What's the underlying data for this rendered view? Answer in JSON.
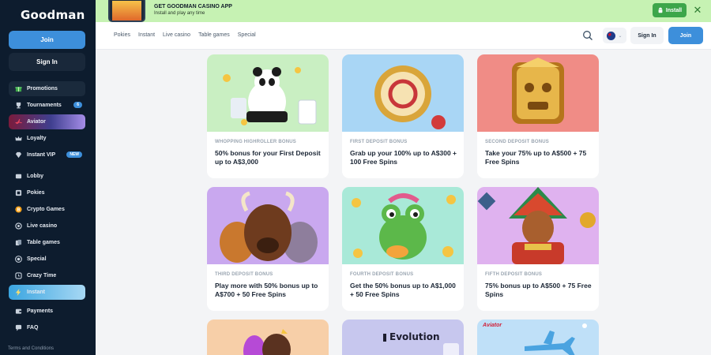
{
  "sidebar": {
    "logo": "Goodman",
    "join_label": "Join",
    "signin_label": "Sign In",
    "menu_group1": [
      {
        "label": "Promotions",
        "icon": "gift-icon"
      },
      {
        "label": "Tournaments",
        "icon": "trophy-icon",
        "badge": "6"
      },
      {
        "label": "Aviator",
        "icon": "plane-icon"
      },
      {
        "label": "Loyalty",
        "icon": "crown-icon"
      },
      {
        "label": "Instant VIP",
        "icon": "diamond-icon",
        "badge": "NEW"
      }
    ],
    "menu_group2": [
      {
        "label": "Lobby",
        "icon": "lobby-icon"
      },
      {
        "label": "Pokies",
        "icon": "cherry-icon"
      },
      {
        "label": "Crypto Games",
        "icon": "bitcoin-icon"
      },
      {
        "label": "Live casino",
        "icon": "live-icon"
      },
      {
        "label": "Table games",
        "icon": "cards-icon"
      },
      {
        "label": "Special",
        "icon": "star-icon"
      },
      {
        "label": "Crazy Time",
        "icon": "clock-icon"
      },
      {
        "label": "Instant",
        "icon": "lightning-icon"
      }
    ],
    "menu_group3": [
      {
        "label": "Payments",
        "icon": "wallet-icon"
      },
      {
        "label": "FAQ",
        "icon": "chat-icon"
      }
    ],
    "terms": "Terms and Conditions"
  },
  "banner": {
    "title": "GET GOODMAN CASINO APP",
    "subtitle": "Install and play any time",
    "install_label": "Install",
    "close_icon": "close-icon"
  },
  "header": {
    "nav": [
      "Pokies",
      "Instant",
      "Live casino",
      "Table games",
      "Special"
    ],
    "signin_label": "Sign In",
    "join_label": "Join"
  },
  "cards": [
    {
      "kicker": "WHOPPING HIGHROLLER BONUS",
      "title": "50% bonus for your First Deposit up to A$3,000"
    },
    {
      "kicker": "FIRST DEPOSIT BONUS",
      "title": "Grab up your 100% up to A$300 + 100 Free Spins"
    },
    {
      "kicker": "SECOND DEPOSIT BONUS",
      "title": "Take your 75% up to A$500 + 75 Free Spins"
    },
    {
      "kicker": "THIRD DEPOSIT BONUS",
      "title": "Play more with 50% bonus up to A$700 + 50 Free Spins"
    },
    {
      "kicker": "FOURTH DEPOSIT BONUS",
      "title": "Get the 50% bonus up to A$1,000 + 50 Free Spins"
    },
    {
      "kicker": "FIFTH DEPOSIT BONUS",
      "title": "75% bonus up to A$500 + 75 Free Spins"
    }
  ],
  "partial_cards": {
    "evolution_label": "Evolution",
    "aviator_label": "Aviator"
  },
  "colors": {
    "sidebar_bg": "#0d1c2e",
    "accent": "#3d8fdb",
    "banner_bg": "#c6f2b3",
    "install_green": "#3ca64a"
  }
}
